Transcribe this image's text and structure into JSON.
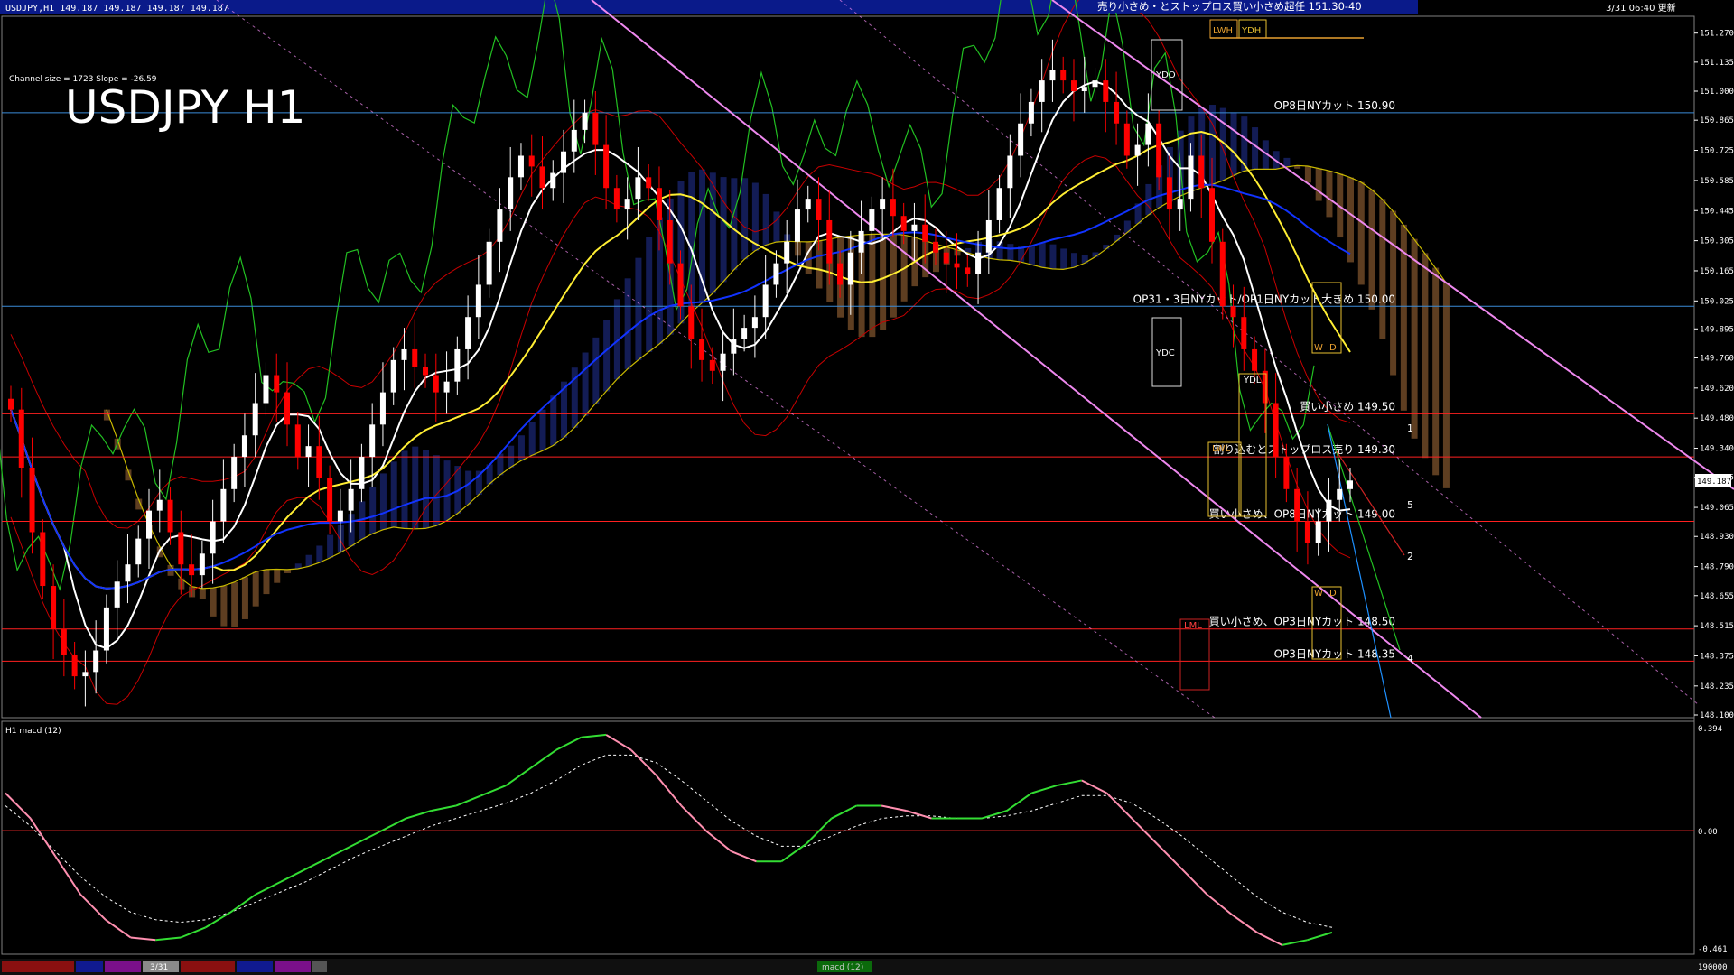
{
  "header": {
    "symbol_info": "USDJPY,H1  149.187 149.187 149.187 149.187",
    "timestamp": "3/31 06:40 更新",
    "top_label": "売り小さめ・とストップロス買い小さめ超任 151.30-40",
    "ydh_tag": "YDH",
    "lwh_tag": "LWH"
  },
  "overlay": {
    "title": "USDJPY H1",
    "channel_info": "Channel size = 1723 Slope = -26.59"
  },
  "colors": {
    "background": "#000000",
    "bull_candle": "#ffffff",
    "bear_candle": "#ff0000",
    "ma_white": "#ffffff",
    "ma_yellow": "#ffee33",
    "ma_blue": "#1133ff",
    "kumo_blue": "#2a3dbd",
    "kumo_orange": "#d08a4a",
    "band_red": "#c80000",
    "chikou_green": "#22c022",
    "channel_pink": "#ee88ee",
    "level_red": "#ff2020",
    "level_blue": "#3a8bd8",
    "macd_up": "#33dd33",
    "macd_down": "#ff8fb0",
    "price_box": "#ffffff"
  },
  "price_axis": {
    "ticks": [
      "151.270",
      "151.135",
      "151.000",
      "150.865",
      "150.725",
      "150.585",
      "150.445",
      "150.305",
      "150.165",
      "150.025",
      "149.895",
      "149.760",
      "149.620",
      "149.480",
      "149.340",
      "149.205",
      "149.065",
      "148.930",
      "148.790",
      "148.655",
      "148.515",
      "148.375",
      "148.235",
      "148.100"
    ],
    "current_price": "149.187",
    "ymin": 148.1,
    "ymax": 151.34
  },
  "levels": [
    {
      "price": 150.9,
      "label": "OP8日NYカット 150.90",
      "color": "#3a8bd8"
    },
    {
      "price": 150.0,
      "label": "OP31・3日NYカット/OP1日NYカット大きめ 150.00",
      "color": "#3a8bd8"
    },
    {
      "price": 149.5,
      "label": "買い小さめ 149.50",
      "color": "#ff2020"
    },
    {
      "price": 149.3,
      "label": "割り込むとストップロス売り 149.30",
      "color": "#ff2020"
    },
    {
      "price": 149.0,
      "label": "買い小さめ、OP8日NYカット 149.00",
      "color": "#ff2020"
    },
    {
      "price": 148.5,
      "label": "買い小さめ、OP3日NYカット 148.50",
      "color": "#ff2020"
    },
    {
      "price": 148.35,
      "label": "OP3日NYカット 148.35",
      "color": "#ff2020"
    }
  ],
  "box_tags": {
    "ydo": "YDO",
    "ydc": "YDC",
    "ydl": "YDL",
    "lwl": "LWL",
    "lml": "LML",
    "w1": "W",
    "d1": "D",
    "w2": "W",
    "d2": "D"
  },
  "projection_labels": [
    "1",
    "5",
    "2",
    "4"
  ],
  "macd": {
    "label": "H1  macd (12)",
    "ticks": [
      "0.394",
      "0.00",
      "-0.461"
    ]
  },
  "bottom_bar": {
    "date_tab": "3/31",
    "macd_tab": "macd (12)",
    "right_value": "190000"
  },
  "chart_data": [
    {
      "type": "candlestick",
      "title": "USDJPY H1",
      "ylim": [
        148.1,
        151.34
      ],
      "overlays": [
        "MA white",
        "MA yellow",
        "MA blue",
        "Ichimoku cloud",
        "Bollinger bands",
        "Regression channel"
      ],
      "close": [
        149.52,
        149.25,
        148.95,
        148.7,
        148.5,
        148.38,
        148.28,
        148.3,
        148.4,
        148.6,
        148.72,
        148.8,
        148.92,
        149.05,
        149.1,
        148.95,
        148.8,
        148.75,
        148.85,
        149.0,
        149.15,
        149.3,
        149.4,
        149.55,
        149.68,
        149.6,
        149.45,
        149.3,
        149.35,
        149.2,
        149.0,
        149.05,
        149.15,
        149.3,
        149.45,
        149.6,
        149.75,
        149.8,
        149.72,
        149.68,
        149.6,
        149.65,
        149.8,
        149.95,
        150.1,
        150.3,
        150.45,
        150.6,
        150.7,
        150.65,
        150.55,
        150.62,
        150.72,
        150.82,
        150.9,
        150.75,
        150.55,
        150.45,
        150.5,
        150.6,
        150.55,
        150.4,
        150.2,
        150.0,
        149.85,
        149.75,
        149.7,
        149.78,
        149.85,
        149.9,
        149.95,
        150.1,
        150.2,
        150.3,
        150.45,
        150.5,
        150.4,
        150.2,
        150.1,
        150.25,
        150.35,
        150.45,
        150.5,
        150.42,
        150.35,
        150.38,
        150.3,
        150.25,
        150.2,
        150.18,
        150.15,
        150.25,
        150.4,
        150.55,
        150.7,
        150.85,
        150.95,
        151.05,
        151.1,
        151.05,
        151.0,
        151.02,
        151.05,
        150.95,
        150.85,
        150.7,
        150.75,
        150.85,
        150.6,
        150.45,
        150.5,
        150.7,
        150.55,
        150.3,
        150.0,
        149.95,
        149.8,
        149.7,
        149.55,
        149.3,
        149.15,
        149.0,
        148.9,
        149.0,
        149.1,
        149.15,
        149.19
      ]
    },
    {
      "type": "line",
      "title": "macd (12)",
      "ylim": [
        -0.461,
        0.394
      ],
      "series": [
        {
          "name": "macd",
          "values": [
            0.15,
            0.05,
            -0.1,
            -0.25,
            -0.35,
            -0.42,
            -0.43,
            -0.42,
            -0.38,
            -0.32,
            -0.25,
            -0.2,
            -0.15,
            -0.1,
            -0.05,
            0.0,
            0.05,
            0.08,
            0.1,
            0.14,
            0.18,
            0.25,
            0.32,
            0.37,
            0.38,
            0.32,
            0.22,
            0.1,
            0.0,
            -0.08,
            -0.12,
            -0.12,
            -0.05,
            0.05,
            0.1,
            0.1,
            0.08,
            0.05,
            0.05,
            0.05,
            0.08,
            0.15,
            0.18,
            0.2,
            0.15,
            0.05,
            -0.05,
            -0.15,
            -0.25,
            -0.33,
            -0.4,
            -0.45,
            -0.43,
            -0.4
          ]
        },
        {
          "name": "signal",
          "values": [
            0.1,
            0.02,
            -0.08,
            -0.18,
            -0.26,
            -0.32,
            -0.35,
            -0.36,
            -0.35,
            -0.32,
            -0.28,
            -0.24,
            -0.2,
            -0.15,
            -0.1,
            -0.06,
            -0.02,
            0.02,
            0.05,
            0.08,
            0.11,
            0.15,
            0.2,
            0.26,
            0.3,
            0.3,
            0.27,
            0.2,
            0.12,
            0.04,
            -0.02,
            -0.06,
            -0.06,
            -0.02,
            0.02,
            0.05,
            0.06,
            0.06,
            0.05,
            0.05,
            0.06,
            0.08,
            0.11,
            0.14,
            0.14,
            0.11,
            0.05,
            -0.02,
            -0.1,
            -0.18,
            -0.26,
            -0.32,
            -0.36,
            -0.38
          ]
        }
      ]
    }
  ]
}
